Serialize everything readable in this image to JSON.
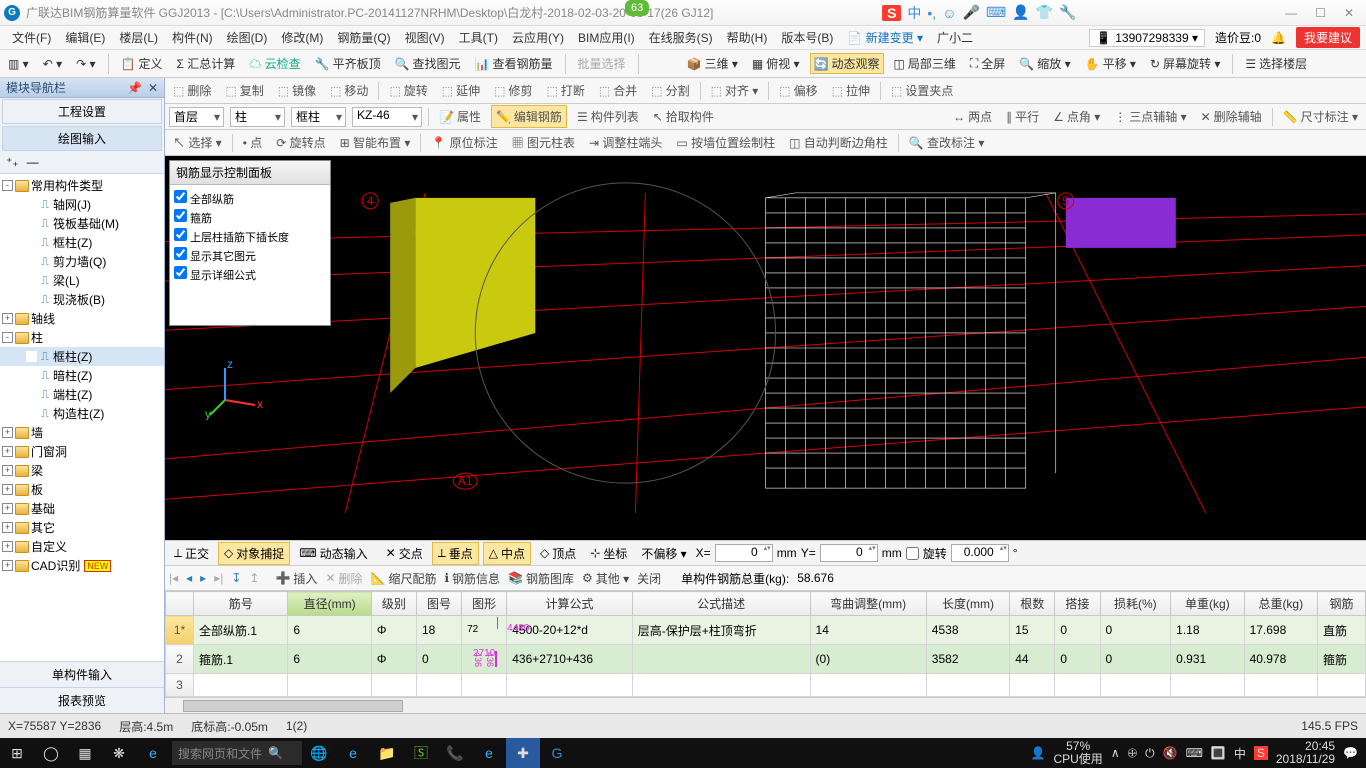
{
  "title": "广联达BIM钢筋算量软件 GGJ2013 - [C:\\Users\\Administrator.PC-20141127NRHM\\Desktop\\白龙村-2018-02-03-20-08-17(26       GJ12]",
  "badge": "63",
  "ime": {
    "sogou": "S",
    "items": [
      "中",
      "•,",
      "☺",
      "🎤",
      "⌨",
      "👤",
      "👕",
      "🔧"
    ]
  },
  "window_controls": [
    "—",
    "☐",
    "✕"
  ],
  "menus": [
    "文件(F)",
    "编辑(E)",
    "楼层(L)",
    "构件(N)",
    "绘图(D)",
    "修改(M)",
    "钢筋量(Q)",
    "视图(V)",
    "工具(T)",
    "云应用(Y)",
    "BIM应用(I)",
    "在线服务(S)",
    "帮助(H)",
    "版本号(B)"
  ],
  "menu_right": {
    "new_change": "新建变更",
    "user": "广小二",
    "phone": "13907298339 ▾",
    "cost": "造价豆:0",
    "bell": "🔔",
    "suggest": "我要建议"
  },
  "quickbar": [
    "▥ ▾",
    "↶ ▾",
    "↷ ▾"
  ],
  "maintoolbar": [
    "定义",
    "Σ 汇总计算",
    "☁ 云检查",
    "平齐板顶",
    "查找图元",
    "查看钢筋量",
    "批量选择",
    "",
    "三维 ▾",
    "俯视 ▾",
    "动态观察",
    "局部三维",
    "全屏",
    "缩放 ▾",
    "平移 ▾",
    "屏幕旋转 ▾",
    "选择楼层"
  ],
  "maintoolbar_active": 10,
  "left": {
    "header": "模块导航栏",
    "tabs": [
      "工程设置",
      "绘图输入"
    ],
    "mini": [
      "⁺₊",
      "—"
    ],
    "tree": [
      {
        "l": 1,
        "exp": "-",
        "ico": "f",
        "t": "常用构件类型"
      },
      {
        "l": 2,
        "ico": "c",
        "c": "#1e66b1",
        "t": "轴网(J)"
      },
      {
        "l": 2,
        "ico": "c",
        "c": "#1e66b1",
        "t": "筏板基础(M)"
      },
      {
        "l": 2,
        "ico": "c",
        "c": "#1e66b1",
        "t": "框柱(Z)"
      },
      {
        "l": 2,
        "ico": "c",
        "c": "#1e66b1",
        "t": "剪力墙(Q)"
      },
      {
        "l": 2,
        "ico": "c",
        "c": "#1e66b1",
        "t": "梁(L)"
      },
      {
        "l": 2,
        "ico": "c",
        "c": "#1e66b1",
        "t": "现浇板(B)"
      },
      {
        "l": 1,
        "exp": "+",
        "ico": "f",
        "t": "轴线"
      },
      {
        "l": 1,
        "exp": "-",
        "ico": "f",
        "t": "柱"
      },
      {
        "l": 2,
        "ico": "c",
        "c": "#1e66b1",
        "t": "框柱(Z)",
        "sel": true
      },
      {
        "l": 2,
        "ico": "c",
        "c": "#1e66b1",
        "t": "暗柱(Z)"
      },
      {
        "l": 2,
        "ico": "c",
        "c": "#1e66b1",
        "t": "端柱(Z)"
      },
      {
        "l": 2,
        "ico": "c",
        "c": "#1e66b1",
        "t": "构造柱(Z)"
      },
      {
        "l": 1,
        "exp": "+",
        "ico": "f",
        "t": "墙"
      },
      {
        "l": 1,
        "exp": "+",
        "ico": "f",
        "t": "门窗洞"
      },
      {
        "l": 1,
        "exp": "+",
        "ico": "f",
        "t": "梁"
      },
      {
        "l": 1,
        "exp": "+",
        "ico": "f",
        "t": "板"
      },
      {
        "l": 1,
        "exp": "+",
        "ico": "f",
        "t": "基础"
      },
      {
        "l": 1,
        "exp": "+",
        "ico": "f",
        "t": "其它"
      },
      {
        "l": 1,
        "exp": "+",
        "ico": "f",
        "t": "自定义"
      },
      {
        "l": 1,
        "exp": "+",
        "ico": "f",
        "t": "CAD识别",
        "new": "NEW"
      }
    ],
    "bottom_tabs": [
      "单构件输入",
      "报表预览"
    ]
  },
  "editbar": [
    "删除",
    "复制",
    "镜像",
    "移动",
    "旋转",
    "延伸",
    "修剪",
    "打断",
    "合并",
    "分割",
    "对齐 ▾",
    "偏移",
    "拉伸",
    "设置夹点"
  ],
  "combos": {
    "floor": "首层",
    "cat": "柱",
    "type": "框柱",
    "inst": "KZ-46"
  },
  "propbar": [
    "属性",
    "编辑钢筋",
    "构件列表",
    "拾取构件"
  ],
  "propbar_active": 1,
  "dimbar": [
    "两点",
    "平行",
    "点角 ▾",
    "三点辅轴 ▾",
    "删除辅轴",
    "尺寸标注 ▾"
  ],
  "selbar": [
    "选择 ▾",
    "点",
    "旋转点",
    "智能布置 ▾",
    "原位标注",
    "图元柱表",
    "调整柱端头",
    "按墙位置绘制柱",
    "自动判断边角柱",
    "查改标注 ▾"
  ],
  "floatpanel": {
    "title": "钢筋显示控制面板",
    "items": [
      "全部纵筋",
      "箍筋",
      "上层柱插筋下插长度",
      "显示其它图元",
      "显示详细公式"
    ]
  },
  "snapbar": {
    "items": [
      "正交",
      "对象捕捉",
      "动态输入",
      "交点",
      "垂点",
      "中点",
      "顶点",
      "坐标",
      "不偏移 ▾"
    ],
    "active": [
      1,
      4,
      5
    ],
    "x": "0",
    "y": "0",
    "rot": "0.000",
    "mm": "mm",
    "xl": "X=",
    "yl": "Y=",
    "rotl": "旋转",
    "deg": "°"
  },
  "rebarops": {
    "nav": [
      "|◂",
      "◂",
      "▸",
      "▸|",
      "↧",
      "↥"
    ],
    "btns": [
      "插入",
      "删除",
      "缩尺配筋",
      "钢筋信息",
      "钢筋图库",
      "其他 ▾",
      "关闭"
    ],
    "total_label": "单构件钢筋总重(kg):",
    "total": "58.676"
  },
  "grid": {
    "headers": [
      "",
      "筋号",
      "直径(mm)",
      "级别",
      "图号",
      "图形",
      "计算公式",
      "公式描述",
      "弯曲调整(mm)",
      "长度(mm)",
      "根数",
      "搭接",
      "损耗(%)",
      "单重(kg)",
      "总重(kg)",
      "钢筋"
    ],
    "hl_col": 2,
    "rows": [
      {
        "n": "1*",
        "hl": true,
        "cells": [
          "全部纵筋.1",
          "6",
          "Φ",
          "18",
          {
            "shape": "line",
            "a": "72",
            "b": "4480"
          },
          "4500-20+12*d",
          "层高-保护层+柱顶弯折",
          "14",
          "4538",
          "15",
          "0",
          "0",
          "1.18",
          "17.698",
          "直筋"
        ]
      },
      {
        "n": "2",
        "cells": [
          "箍筋.1",
          "6",
          "Φ",
          "0",
          {
            "shape": "rect",
            "a": "436",
            "b": "2710",
            "c": "436"
          },
          "436+2710+436",
          "",
          "(0)",
          "3582",
          "44",
          "0",
          "0",
          "0.931",
          "40.978",
          "箍筋"
        ]
      },
      {
        "n": "3",
        "empty": true
      }
    ]
  },
  "status": {
    "xy": "X=75587 Y=2836",
    "floor": "层高:4.5m",
    "bott": "底标高:-0.05m",
    "sel": "1(2)",
    "fps": "145.5 FPS"
  },
  "taskbar": {
    "start": "⊞",
    "search_ph": "搜索网页和文件",
    "apps": [
      "◯",
      "▦",
      "❋",
      "e",
      "🌐",
      "🌀",
      "📁",
      "🅂",
      "📞",
      "e",
      "✚",
      "G"
    ],
    "active_app": 9,
    "cpu_pct": "57%",
    "cpu_lbl": "CPU使用",
    "tray": [
      "∧",
      "🕀",
      "⏻",
      "🔇",
      "⌨",
      "🔳",
      "中",
      "S"
    ],
    "time": "20:45",
    "date": "2018/11/29"
  },
  "axis_markers": {
    "top_left": "4",
    "top_right": "5",
    "bottom": "A1"
  }
}
